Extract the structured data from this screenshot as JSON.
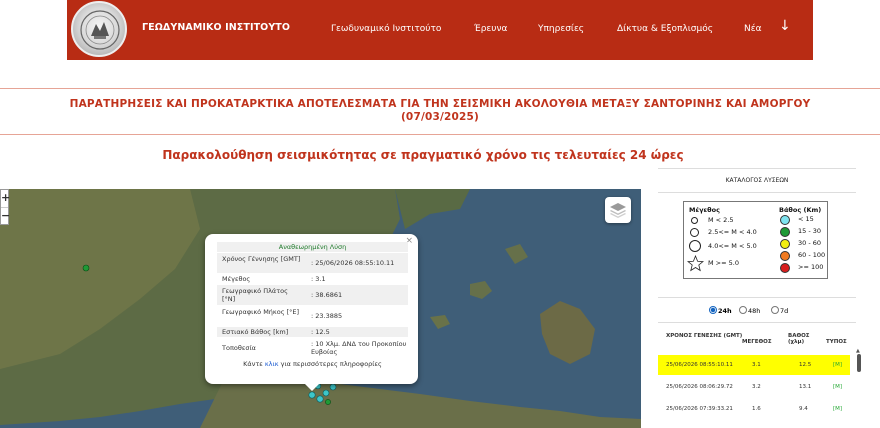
{
  "header": {
    "brand": "ΓΕΩΔΥΝΑΜΙΚΟ ΙΝΣΤΙΤΟΥΤΟ",
    "nav": [
      "Γεωδυναμικό Ινστιτούτο",
      "Έρευνα",
      "Υπηρεσίες",
      "Δίκτυα & Εξοπλισμός",
      "Νέα"
    ],
    "arrow": "↓",
    "brand_color": "#b82c14"
  },
  "headline": {
    "line1": "ΠΑΡΑΤΗΡΗΣΕΙΣ ΚΑΙ ΠΡΟΚΑΤΑΡΚΤΙΚΑ ΑΠΟΤΕΛΕΣΜΑΤΑ ΓΙΑ ΤΗΝ ΣΕΙΣΜΙΚΗ ΑΚΟΛΟΥΘΙΑ ΜΕΤΑΞΥ ΣΑΝΤΟΡΙΝΗΣ ΚΑΙ ΑΜΟΡΓΟΥ",
    "line2": "(07/03/2025)"
  },
  "subtitle": "Παρακολούθηση σεισμικότητας σε πραγματικό χρόνο τις τελευταίες 24 ώρες",
  "map": {
    "zoom_in": "+",
    "zoom_out": "−",
    "popup": {
      "close": "×",
      "title": "Αναθεωρημένη Λύση",
      "rows": [
        {
          "label": "Χρόνος Γέννησης [GMT]",
          "value": ": 25/06/2026 08:55:10.11"
        },
        {
          "label": "Μέγεθος",
          "value": ": 3.1"
        },
        {
          "label": "Γεωγραφικό Πλάτος [°N]",
          "value": ": 38.6861"
        },
        {
          "label": "Γεωγραφικό Μήκος [°E]",
          "value": ": 23.3885"
        },
        {
          "label": "Εστιακό Βάθος [km]",
          "value": ": 12.5"
        },
        {
          "label": "Τοποθεσία",
          "value": ": 10 Χλμ. ΔΝΔ του Προκοπίου Ευβοίας"
        }
      ],
      "footer_pre": "Κάντε ",
      "footer_link": "κλικ",
      "footer_post": " για περισσότερες πληροφορίες"
    }
  },
  "legend": {
    "title": "ΚΑΤΑΛΟΓΟΣ ΛΥΣΕΩΝ",
    "magnitude_header": "Μέγεθος",
    "depth_header": "Βάθος (Km)",
    "magnitudes": [
      "M < 2.5",
      "2.5<= M < 4.0",
      "4.0<= M < 5.0",
      "M >= 5.0"
    ],
    "depths": [
      {
        "label": "< 15",
        "color": "#7fe3ef"
      },
      {
        "label": "15 - 30",
        "color": "#1f9a36"
      },
      {
        "label": "30 - 60",
        "color": "#f3ee12"
      },
      {
        "label": "60 - 100",
        "color": "#f07a21"
      },
      {
        "label": ">= 100",
        "color": "#d81f1f"
      }
    ]
  },
  "period": {
    "options": [
      "24h",
      "48h",
      "7d"
    ],
    "selected": "24h"
  },
  "table": {
    "headers": [
      "ΧΡΟΝΟΣ ΓΕΝΕΣΗΣ (GMT)",
      "ΜΕΓΕΘΟΣ",
      "ΒΑΘΟΣ (χλμ)",
      "ΤΥΠΟΣ"
    ],
    "rows": [
      {
        "time": "25/06/2026 08:55:10.11",
        "mag": "3.1",
        "depth": "12.5",
        "type": "[M]"
      },
      {
        "time": "25/06/2026 08:06:29.72",
        "mag": "3.2",
        "depth": "13.1",
        "type": "[M]"
      },
      {
        "time": "25/06/2026 07:39:33.21",
        "mag": "1.6",
        "depth": "9.4",
        "type": "[M]"
      }
    ]
  }
}
